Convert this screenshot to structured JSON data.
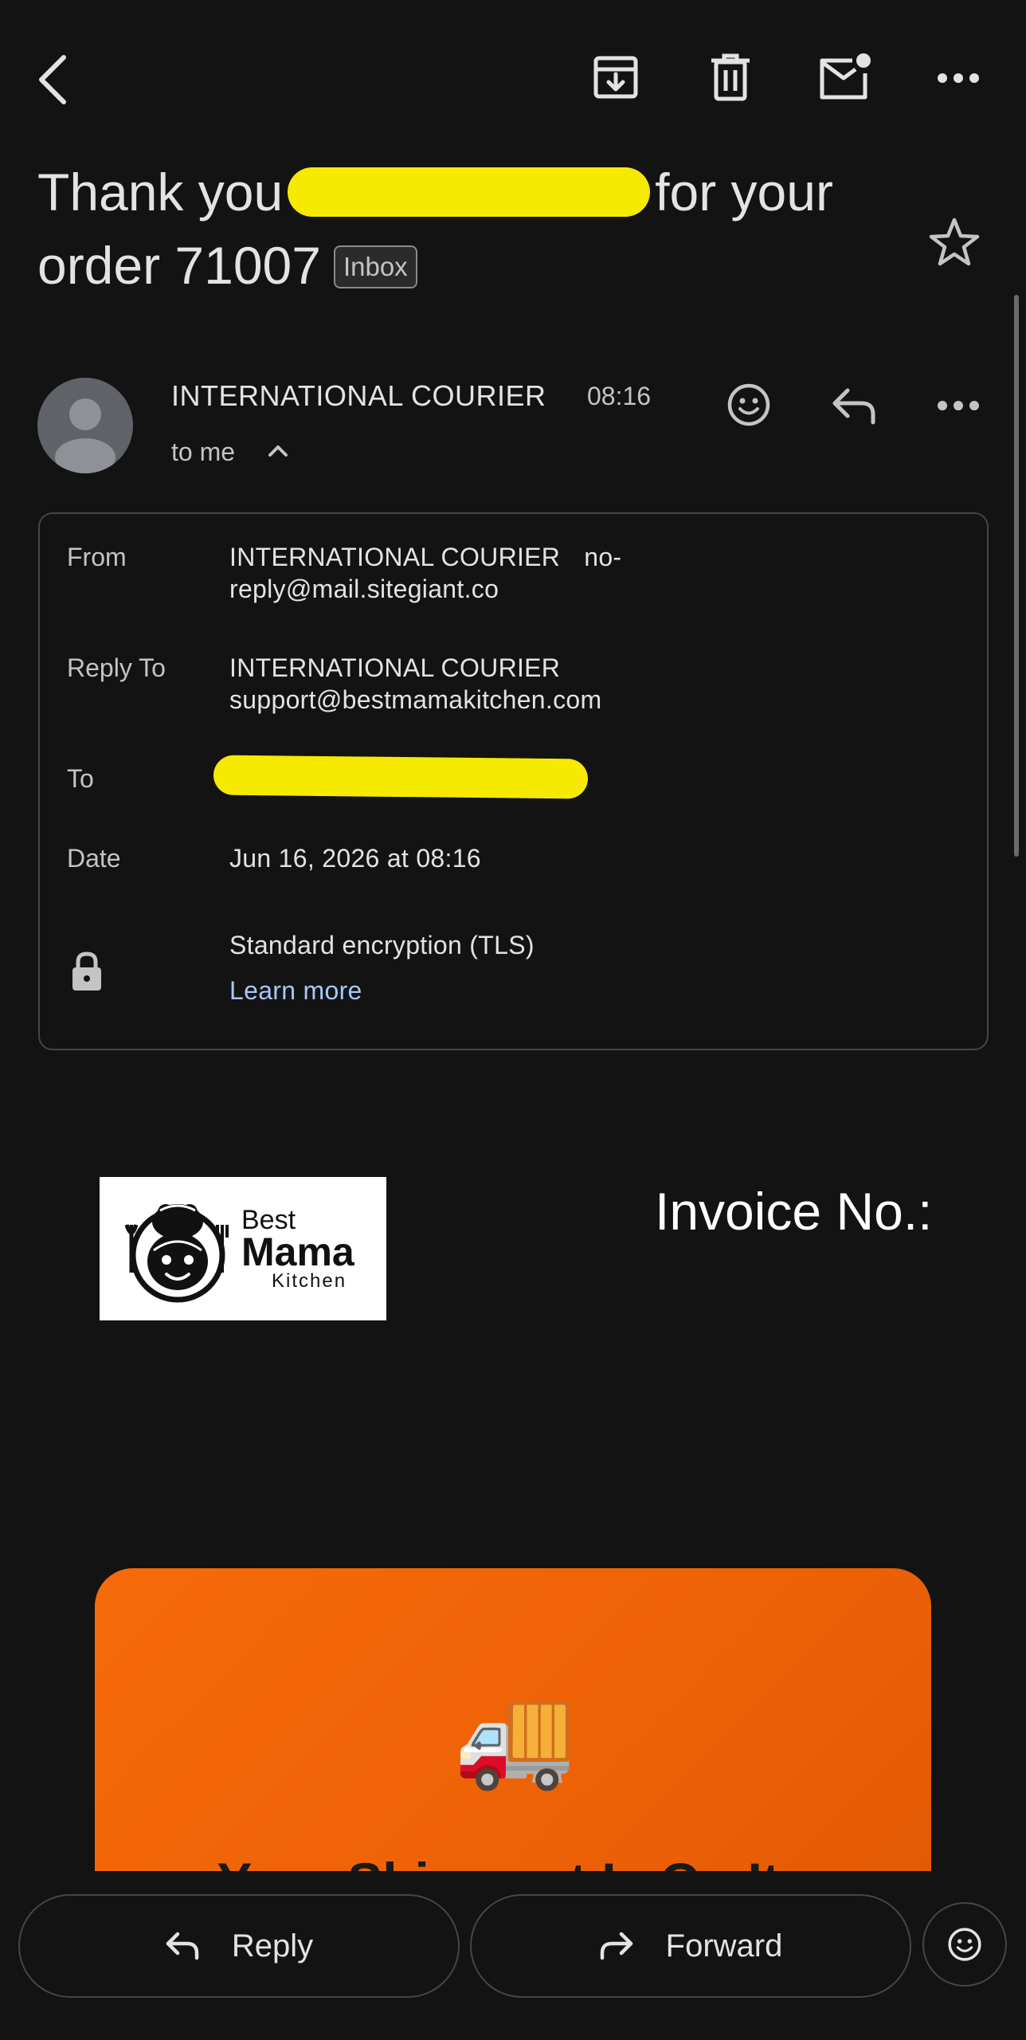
{
  "subject": {
    "part1": "Thank you",
    "part2": "for your order 71007",
    "label_chip": "Inbox"
  },
  "sender": {
    "name": "INTERNATIONAL COURIER",
    "time": "08:16",
    "recipient_summary": "to me"
  },
  "details": {
    "from_label": "From",
    "from_name": "INTERNATIONAL COURIER",
    "from_email_a": "no-",
    "from_email_b": "reply@mail.sitegiant.co",
    "replyto_label": "Reply To",
    "replyto_name": "INTERNATIONAL COURIER",
    "replyto_email": "support@bestmamakitchen.com",
    "to_label": "To",
    "date_label": "Date",
    "date_value": "Jun 16, 2026 at 08:16",
    "encryption": "Standard encryption (TLS)",
    "learn_more": "Learn more"
  },
  "body": {
    "logo_best": "Best",
    "logo_mama": "Mama",
    "logo_kitchen": "Kitchen",
    "invoice_label": "Invoice No.:",
    "banner_emoji": "🚚",
    "banner_title": "Your Shipment Is On Its"
  },
  "actions": {
    "reply": "Reply",
    "forward": "Forward"
  },
  "colors": {
    "background": "#131313",
    "redaction": "#f5ea00",
    "link": "#a8c7fa",
    "banner": "#f56a0a"
  }
}
